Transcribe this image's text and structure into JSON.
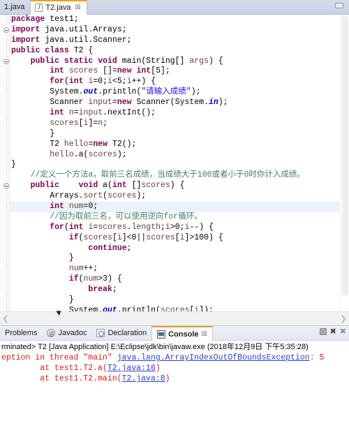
{
  "window": {
    "minimize_label": "Minimize",
    "accent_color": "#f3a11b"
  },
  "editor_tabs": [
    {
      "label": "1.java",
      "active": false,
      "icon": "java-file-icon"
    },
    {
      "label": "T2.java",
      "active": true,
      "icon": "java-file-icon",
      "close": "☒"
    }
  ],
  "code": {
    "language": "java",
    "highlighted_line_index": 18,
    "lines": [
      {
        "folding": "",
        "tokens": [
          {
            "t": "package ",
            "c": "kw"
          },
          {
            "t": "test1;",
            "c": "plain"
          }
        ]
      },
      {
        "folding": "collapse",
        "tokens": [
          {
            "t": "import ",
            "c": "kw"
          },
          {
            "t": "java.util.Arrays;",
            "c": "plain"
          }
        ]
      },
      {
        "folding": "",
        "tokens": [
          {
            "t": "import ",
            "c": "kw"
          },
          {
            "t": "java.util.Scanner;",
            "c": "plain"
          }
        ]
      },
      {
        "folding": "",
        "tokens": [
          {
            "t": "public class ",
            "c": "kw"
          },
          {
            "t": "T2 {",
            "c": "plain"
          }
        ]
      },
      {
        "folding": "collapse",
        "tokens": [
          {
            "t": "    ",
            "c": "plain"
          },
          {
            "t": "public static void ",
            "c": "kw"
          },
          {
            "t": "main(",
            "c": "plain"
          },
          {
            "t": "String[] ",
            "c": "plain"
          },
          {
            "t": "args",
            "c": "loc"
          },
          {
            "t": ") {",
            "c": "plain"
          }
        ]
      },
      {
        "folding": "",
        "tokens": [
          {
            "t": "        ",
            "c": "plain"
          },
          {
            "t": "int ",
            "c": "kw"
          },
          {
            "t": "scores",
            "c": "loc"
          },
          {
            "t": " []=",
            "c": "plain"
          },
          {
            "t": "new int",
            "c": "kw"
          },
          {
            "t": "[5];",
            "c": "plain"
          }
        ]
      },
      {
        "folding": "",
        "tokens": [
          {
            "t": "        ",
            "c": "plain"
          },
          {
            "t": "for",
            "c": "kw"
          },
          {
            "t": "(",
            "c": "plain"
          },
          {
            "t": "int ",
            "c": "kw"
          },
          {
            "t": "i",
            "c": "loc"
          },
          {
            "t": "=0;",
            "c": "plain"
          },
          {
            "t": "i",
            "c": "loc"
          },
          {
            "t": "<5;",
            "c": "plain"
          },
          {
            "t": "i",
            "c": "loc"
          },
          {
            "t": "++) {",
            "c": "plain"
          }
        ]
      },
      {
        "folding": "",
        "tokens": [
          {
            "t": "        System.",
            "c": "plain"
          },
          {
            "t": "out",
            "c": "fld"
          },
          {
            "t": ".println(",
            "c": "plain"
          },
          {
            "t": "\"请输入成绩\"",
            "c": "str"
          },
          {
            "t": ");",
            "c": "plain"
          }
        ]
      },
      {
        "folding": "",
        "tokens": [
          {
            "t": "        Scanner ",
            "c": "plain"
          },
          {
            "t": "input",
            "c": "loc"
          },
          {
            "t": "=",
            "c": "plain"
          },
          {
            "t": "new ",
            "c": "kw"
          },
          {
            "t": "Scanner(System.",
            "c": "plain"
          },
          {
            "t": "in",
            "c": "fld"
          },
          {
            "t": ");",
            "c": "plain"
          }
        ]
      },
      {
        "folding": "",
        "tokens": [
          {
            "t": "        ",
            "c": "plain"
          },
          {
            "t": "int ",
            "c": "kw"
          },
          {
            "t": "n",
            "c": "loc"
          },
          {
            "t": "=",
            "c": "plain"
          },
          {
            "t": "input",
            "c": "loc"
          },
          {
            "t": ".nextInt();",
            "c": "plain"
          }
        ]
      },
      {
        "folding": "",
        "tokens": [
          {
            "t": "        ",
            "c": "plain"
          },
          {
            "t": "scores",
            "c": "loc"
          },
          {
            "t": "[",
            "c": "plain"
          },
          {
            "t": "i",
            "c": "loc"
          },
          {
            "t": "]=",
            "c": "plain"
          },
          {
            "t": "n",
            "c": "loc"
          },
          {
            "t": ";",
            "c": "plain"
          }
        ]
      },
      {
        "folding": "",
        "tokens": [
          {
            "t": "        }",
            "c": "plain"
          }
        ]
      },
      {
        "folding": "",
        "tokens": [
          {
            "t": "        T2 ",
            "c": "plain"
          },
          {
            "t": "hello",
            "c": "loc"
          },
          {
            "t": "=",
            "c": "plain"
          },
          {
            "t": "new ",
            "c": "kw"
          },
          {
            "t": "T2();",
            "c": "plain"
          }
        ]
      },
      {
        "folding": "",
        "tokens": [
          {
            "t": "        ",
            "c": "plain"
          },
          {
            "t": "hello",
            "c": "loc"
          },
          {
            "t": ".a(",
            "c": "plain"
          },
          {
            "t": "scores",
            "c": "loc"
          },
          {
            "t": ");",
            "c": "plain"
          }
        ]
      },
      {
        "folding": "",
        "tokens": [
          {
            "t": "}",
            "c": "plain"
          }
        ]
      },
      {
        "folding": "",
        "tokens": [
          {
            "t": "    //定义一个方法a，取前三名成绩，当成绩大于100或者小于0时你计入成绩。",
            "c": "cmt"
          }
        ]
      },
      {
        "folding": "collapse",
        "tokens": [
          {
            "t": "    ",
            "c": "plain"
          },
          {
            "t": "public    void ",
            "c": "kw"
          },
          {
            "t": "a(",
            "c": "plain"
          },
          {
            "t": "int ",
            "c": "kw"
          },
          {
            "t": "[]",
            "c": "plain"
          },
          {
            "t": "scores",
            "c": "loc"
          },
          {
            "t": ") {",
            "c": "plain"
          }
        ]
      },
      {
        "folding": "",
        "tokens": [
          {
            "t": "        Arrays.",
            "c": "plain"
          },
          {
            "t": "sort",
            "c": "var"
          },
          {
            "t": "(",
            "c": "plain"
          },
          {
            "t": "scores",
            "c": "loc"
          },
          {
            "t": ");",
            "c": "plain"
          }
        ]
      },
      {
        "folding": "",
        "tokens": [
          {
            "t": "        ",
            "c": "plain"
          },
          {
            "t": "int ",
            "c": "kw"
          },
          {
            "t": "num",
            "c": "loc"
          },
          {
            "t": "=0;",
            "c": "plain"
          }
        ]
      },
      {
        "folding": "",
        "tokens": [
          {
            "t": "        //因为取前三名，可以使用逆向for循环。",
            "c": "cmt"
          }
        ]
      },
      {
        "folding": "",
        "tokens": [
          {
            "t": "        ",
            "c": "plain"
          },
          {
            "t": "for",
            "c": "kw"
          },
          {
            "t": "(",
            "c": "plain"
          },
          {
            "t": "int ",
            "c": "kw"
          },
          {
            "t": "i",
            "c": "loc"
          },
          {
            "t": "=",
            "c": "plain"
          },
          {
            "t": "scores",
            "c": "loc"
          },
          {
            "t": ".",
            "c": "plain"
          },
          {
            "t": "length",
            "c": "var"
          },
          {
            "t": ";",
            "c": "plain"
          },
          {
            "t": "i",
            "c": "loc"
          },
          {
            "t": ">0;",
            "c": "plain"
          },
          {
            "t": "i",
            "c": "loc"
          },
          {
            "t": "--) {",
            "c": "plain"
          }
        ]
      },
      {
        "folding": "",
        "tokens": [
          {
            "t": "            ",
            "c": "plain"
          },
          {
            "t": "if",
            "c": "kw"
          },
          {
            "t": "(",
            "c": "plain"
          },
          {
            "t": "scores",
            "c": "loc"
          },
          {
            "t": "[",
            "c": "plain"
          },
          {
            "t": "i",
            "c": "loc"
          },
          {
            "t": "]<0||",
            "c": "plain"
          },
          {
            "t": "scores",
            "c": "loc"
          },
          {
            "t": "[",
            "c": "plain"
          },
          {
            "t": "i",
            "c": "loc"
          },
          {
            "t": "]>100) {",
            "c": "plain"
          }
        ]
      },
      {
        "folding": "",
        "tokens": [
          {
            "t": "                ",
            "c": "plain"
          },
          {
            "t": "continue",
            "c": "kw"
          },
          {
            "t": ";",
            "c": "plain"
          }
        ]
      },
      {
        "folding": "",
        "tokens": [
          {
            "t": "            }",
            "c": "plain"
          }
        ]
      },
      {
        "folding": "",
        "tokens": [
          {
            "t": "            ",
            "c": "plain"
          },
          {
            "t": "num",
            "c": "loc"
          },
          {
            "t": "++;",
            "c": "plain"
          }
        ]
      },
      {
        "folding": "",
        "tokens": [
          {
            "t": "            ",
            "c": "plain"
          },
          {
            "t": "if",
            "c": "kw"
          },
          {
            "t": "(",
            "c": "plain"
          },
          {
            "t": "num",
            "c": "loc"
          },
          {
            "t": ">3) {",
            "c": "plain"
          }
        ]
      },
      {
        "folding": "",
        "tokens": [
          {
            "t": "                ",
            "c": "plain"
          },
          {
            "t": "break",
            "c": "kw"
          },
          {
            "t": ";",
            "c": "plain"
          }
        ]
      },
      {
        "folding": "",
        "tokens": [
          {
            "t": "            }",
            "c": "plain"
          }
        ]
      },
      {
        "folding": "",
        "tokens": [
          {
            "t": "            System.",
            "c": "plain"
          },
          {
            "t": "out",
            "c": "fld"
          },
          {
            "t": ".println(",
            "c": "plain"
          },
          {
            "t": "scores",
            "c": "loc"
          },
          {
            "t": "[",
            "c": "plain"
          },
          {
            "t": "i",
            "c": "loc"
          },
          {
            "t": "]);",
            "c": "plain"
          }
        ]
      },
      {
        "folding": "",
        "tokens": [
          {
            "t": "        }",
            "c": "plain"
          }
        ]
      }
    ]
  },
  "view_tabs": [
    {
      "label": "Problems",
      "icon": "problems-icon",
      "active": false
    },
    {
      "label": "Javadoc",
      "icon": "javadoc-icon",
      "active": false
    },
    {
      "label": "Declaration",
      "icon": "declaration-icon",
      "active": false
    },
    {
      "label": "Console",
      "icon": "console-icon",
      "active": true,
      "close": "☒"
    }
  ],
  "view_toolbar": [
    {
      "name": "terminate-button",
      "glyph": ""
    },
    {
      "name": "remove-launch-button",
      "glyph": "✖"
    },
    {
      "name": "remove-all-terminated-button",
      "glyph": "✖"
    }
  ],
  "console": {
    "header": "rminated> T2 [Java Application] E:\\Eclipse\\jdk\\bin\\javaw.exe (2018年12月9日 下午5:35:28)",
    "lines": [
      {
        "type": "error",
        "parts": [
          {
            "t": "eption in thread \"main\" ",
            "k": "text"
          },
          {
            "t": "java.lang.ArrayIndexOutOfBoundsException",
            "k": "link"
          },
          {
            "t": ": 5",
            "k": "text"
          }
        ]
      },
      {
        "type": "error",
        "parts": [
          {
            "t": "\tat test1.T2.a(",
            "k": "text"
          },
          {
            "t": "T2.java:16",
            "k": "link"
          },
          {
            "t": ")",
            "k": "text"
          }
        ]
      },
      {
        "type": "error",
        "parts": [
          {
            "t": "\tat test1.T2.main(",
            "k": "text"
          },
          {
            "t": "T2.java:8",
            "k": "link"
          },
          {
            "t": ")",
            "k": "text"
          }
        ]
      }
    ]
  },
  "colors": {
    "keyword": "#7f0055",
    "string": "#2a00ff",
    "comment": "#3f7f5f",
    "field": "#0000c0",
    "error": "#e01b1b",
    "link": "#2b3ed8",
    "highlight_line": "#eaf2fb"
  }
}
